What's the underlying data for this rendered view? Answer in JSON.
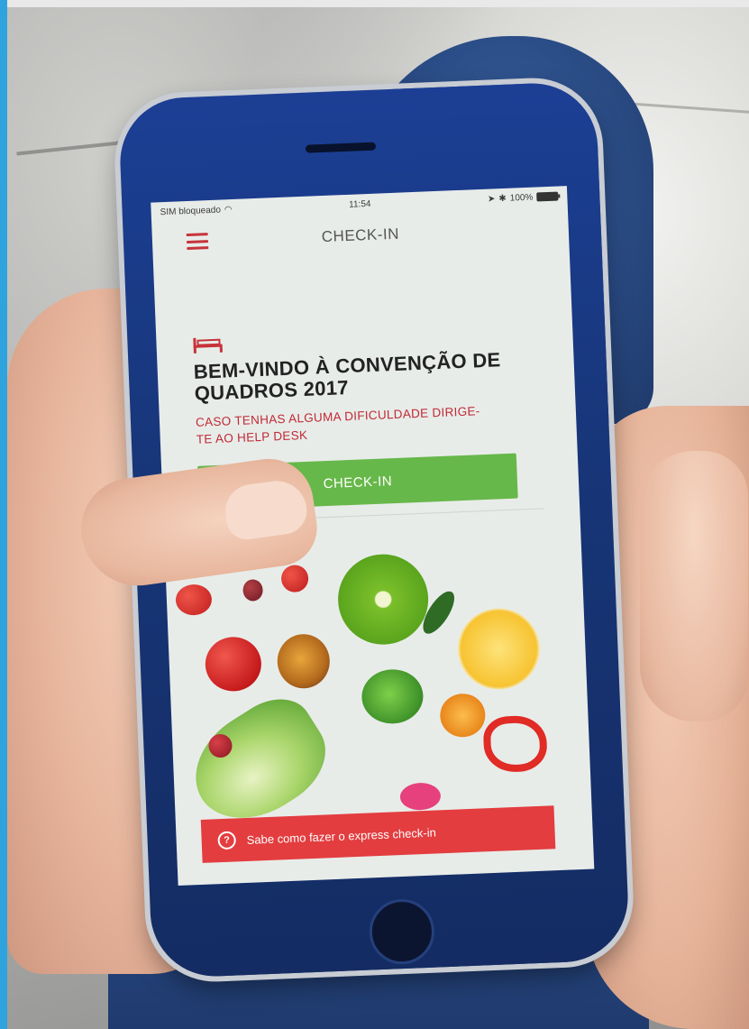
{
  "status_bar": {
    "carrier": "SIM bloqueado",
    "wifi_icon": "wifi-icon",
    "time": "11:54",
    "battery": "100%"
  },
  "nav": {
    "title": "CHECK-IN",
    "menu_icon": "hamburger-menu-icon"
  },
  "welcome": {
    "icon": "bed-icon",
    "title": "BEM-VINDO À CONVENÇÃO DE QUADROS 2017",
    "subtitle": "CASO TENHAS ALGUMA DIFICULDADE DIRIGE-TE AO HELP DESK"
  },
  "checkin_button": {
    "label": "CHECK-IN",
    "color": "#67b84a"
  },
  "express_banner": {
    "icon": "help-icon",
    "text": "Sabe como fazer o express check-in",
    "color": "#e33d3f"
  },
  "colors": {
    "accent_red": "#c12a35",
    "background": "#e8ece9"
  }
}
